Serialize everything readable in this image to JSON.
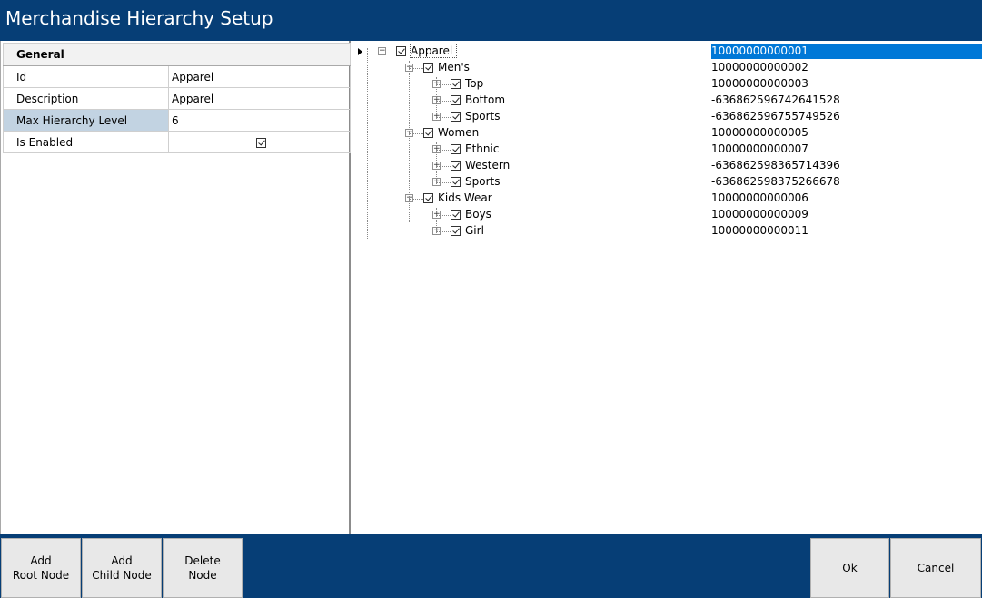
{
  "window": {
    "title": "Merchandise Hierarchy Setup"
  },
  "properties": {
    "section_header": "General",
    "rows": [
      {
        "label": "Id",
        "value": "Apparel"
      },
      {
        "label": "Description",
        "value": "Apparel"
      },
      {
        "label": "Max Hierarchy Level",
        "value": "6"
      },
      {
        "label": "Is Enabled",
        "value": true
      }
    ]
  },
  "tree": {
    "nodes": [
      {
        "label": "Apparel",
        "code": "10000000000001",
        "level": 0,
        "checked": true,
        "selected": true
      },
      {
        "label": "Men's",
        "code": "10000000000002",
        "level": 1,
        "checked": true
      },
      {
        "label": "Top",
        "code": "10000000000003",
        "level": 2,
        "checked": true
      },
      {
        "label": "Bottom",
        "code": "-636862596742641528",
        "level": 2,
        "checked": true
      },
      {
        "label": "Sports",
        "code": "-636862596755749526",
        "level": 2,
        "checked": true
      },
      {
        "label": "Women",
        "code": "10000000000005",
        "level": 1,
        "checked": true
      },
      {
        "label": "Ethnic",
        "code": "10000000000007",
        "level": 2,
        "checked": true
      },
      {
        "label": "Western",
        "code": "-636862598365714396",
        "level": 2,
        "checked": true
      },
      {
        "label": "Sports",
        "code": "-636862598375266678",
        "level": 2,
        "checked": true
      },
      {
        "label": "Kids Wear",
        "code": "10000000000006",
        "level": 1,
        "checked": true
      },
      {
        "label": "Boys",
        "code": "10000000000009",
        "level": 2,
        "checked": true
      },
      {
        "label": "Girl",
        "code": "10000000000011",
        "level": 2,
        "checked": true
      }
    ]
  },
  "buttons": {
    "add_root": "Add\nRoot Node",
    "add_child": "Add\nChild Node",
    "delete": "Delete\nNode",
    "ok": "Ok",
    "cancel": "Cancel"
  },
  "colors": {
    "titlebar": "#063e76",
    "selection": "#0078d7",
    "selected_label_cell": "#c2d3e2"
  }
}
